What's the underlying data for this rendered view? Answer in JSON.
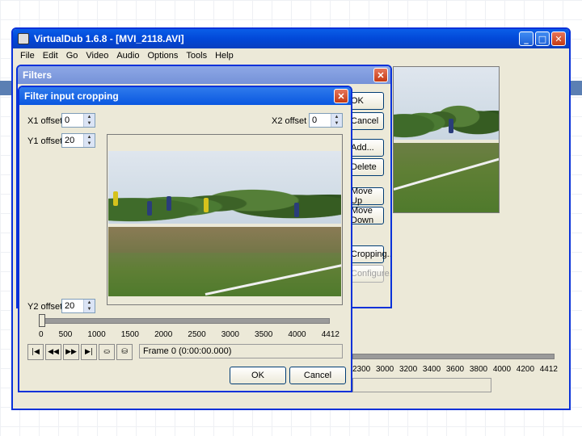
{
  "main_window": {
    "title": "VirtualDub 1.6.8 - [MVI_2118.AVI]",
    "menu": [
      "File",
      "Edit",
      "Go",
      "Video",
      "Audio",
      "Options",
      "Tools",
      "Help"
    ],
    "timeline_ticks": [
      "2300",
      "3000",
      "3200",
      "3400",
      "3600",
      "3800",
      "4000",
      "4200",
      "4412"
    ]
  },
  "filters_dialog": {
    "title": "Filters",
    "buttons": {
      "ok": "OK",
      "cancel": "Cancel",
      "add": "Add...",
      "delete": "Delete",
      "move_up": "Move Up",
      "move_down": "Move Down",
      "cropping": "Cropping...",
      "configure": "Configure..."
    }
  },
  "crop_dialog": {
    "title": "Filter input cropping",
    "x1_label": "X1 offset",
    "x1_value": "0",
    "y1_label": "Y1 offset",
    "y1_value": "20",
    "x2_label": "X2 offset",
    "x2_value": "0",
    "y2_label": "Y2 offset",
    "y2_value": "20",
    "ticks": [
      "0",
      "500",
      "1000",
      "1500",
      "2000",
      "2500",
      "3000",
      "3500",
      "4000",
      "4412"
    ],
    "frame_status": "Frame 0 (0:00:00.000)",
    "ok": "OK",
    "cancel": "Cancel",
    "toolbar_icons": [
      "go-start-icon",
      "prev-key-icon",
      "next-key-icon",
      "go-end-icon",
      "mark-in-icon",
      "mark-out-icon"
    ]
  },
  "colors": {
    "title_blue": "#0a57e0",
    "dialog_bg": "#ece9d8",
    "accent": "#5b7fb3"
  }
}
